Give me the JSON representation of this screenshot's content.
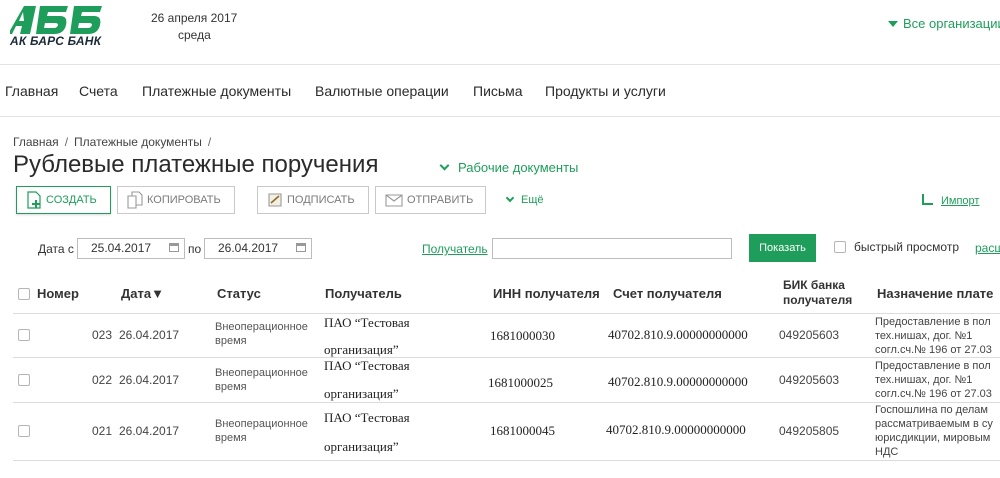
{
  "brand": {
    "logo_text": "АК БАРС БАНК",
    "color": "#1e9e5a"
  },
  "header": {
    "date": "26 апреля 2017",
    "weekday": "среда",
    "org_select": "Все организации"
  },
  "main_nav": [
    "Главная",
    "Счета",
    "Платежные документы",
    "Валютные операции",
    "Письма",
    "Продукты и услуги"
  ],
  "breadcrumbs": [
    "Главная",
    "Платежные документы"
  ],
  "page": {
    "title": "Рублевые платежные поручения",
    "work_docs": "Рабочие документы"
  },
  "toolbar": {
    "create": "СОЗДАТЬ",
    "copy": "КОПИРОВАТЬ",
    "sign": "ПОДПИСАТЬ",
    "send": "ОТПРАВИТЬ",
    "more": "Ещё",
    "import": "Импорт"
  },
  "filters": {
    "date_label": "Дата с",
    "date_from": "25.04.2017",
    "to_label": "по",
    "date_to": "26.04.2017",
    "recipient_link": "Получатель",
    "recipient_value": "",
    "show_button": "Показать",
    "quick_view_label": "быстрый просмотр",
    "cut_link": "расш"
  },
  "table": {
    "headers": {
      "number": "Номер",
      "date": "Дата▼",
      "status": "Статус",
      "recipient": "Получатель",
      "inn": "ИНН получателя",
      "account": "Счет получателя",
      "bik_line1": "БИК банка",
      "bik_line2": "получателя",
      "purpose": "Назначение плате"
    },
    "rows": [
      {
        "number": "023",
        "date": "26.04.2017",
        "status_line1": "Внеоперационное",
        "status_line2": "время",
        "recipient_line1": "ПАО “Тестовая",
        "recipient_line2": "организация”",
        "inn": "1681000030",
        "account": "40702.810.9.00000000000",
        "bik": "049205603",
        "purpose_line1": "Предоставление в пол",
        "purpose_line2": "тех.нишах, дог. №1",
        "purpose_line3": "согл.сч.№ 196 от 27.03"
      },
      {
        "number": "022",
        "date": "26.04.2017",
        "status_line1": "Внеоперационное",
        "status_line2": "время",
        "recipient_line1": "ПАО “Тестовая",
        "recipient_line2": "организация”",
        "inn": "1681000025",
        "account": "40702.810.9.00000000000",
        "bik": "049205603",
        "purpose_line1": "Предоставление в пол",
        "purpose_line2": "тех.нишах, дог. №1",
        "purpose_line3": "согл.сч.№ 196 от 27.03"
      },
      {
        "number": "021",
        "date": "26.04.2017",
        "status_line1": "Внеоперационное",
        "status_line2": "время",
        "recipient_line1": "ПАО “Тестовая",
        "recipient_line2": "организация”",
        "inn": "1681000045",
        "account": "40702.810.9.00000000000",
        "bik": "049205805",
        "purpose_line1": "Госпошлина по делам",
        "purpose_line2": "рассматриваемым в су",
        "purpose_line3": "юрисдикции, мировым",
        "purpose_line4": "НДС"
      }
    ]
  },
  "icons": [
    "logo",
    "chevron-down-icon",
    "create-doc-icon",
    "copy-icon",
    "sign-icon",
    "send-envelope-icon",
    "import-icon",
    "calendar-icon",
    "checkbox-icon"
  ]
}
